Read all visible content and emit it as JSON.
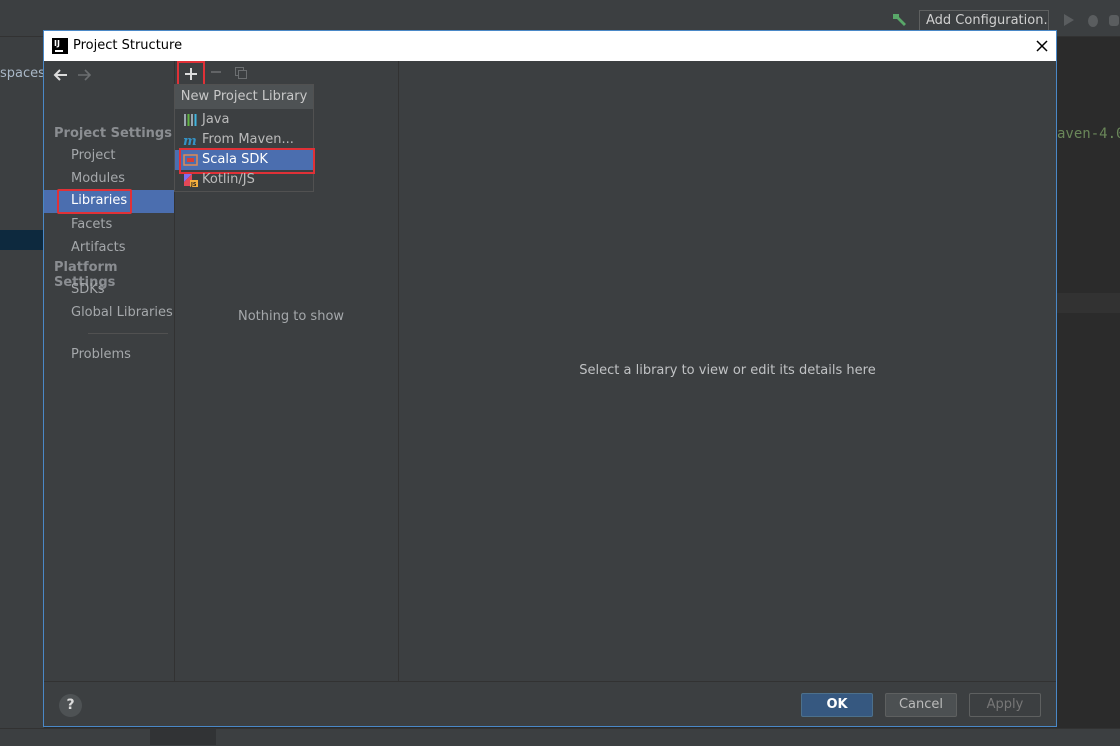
{
  "ide": {
    "add_configuration": "Add Configuration...",
    "left_path_fragment": "spaces\\",
    "code_fragment": "aven-4.0"
  },
  "dialog": {
    "title": "Project Structure",
    "sidebar": {
      "project_settings_header": "Project Settings",
      "project_settings_items": [
        "Project",
        "Modules",
        "Libraries",
        "Facets",
        "Artifacts"
      ],
      "platform_settings_header": "Platform Settings",
      "platform_settings_items": [
        "SDKs",
        "Global Libraries"
      ],
      "problems": "Problems",
      "selected": "Libraries"
    },
    "libraries": {
      "empty_text": "Nothing to show"
    },
    "details": {
      "hint": "Select a library to view or edit its details here"
    },
    "footer": {
      "help": "?",
      "ok": "OK",
      "cancel": "Cancel",
      "apply": "Apply"
    },
    "popup": {
      "header": "New Project Library",
      "items": [
        {
          "label": "Java",
          "icon": "java-library-icon"
        },
        {
          "label": "From Maven...",
          "icon": "maven-icon"
        },
        {
          "label": "Scala SDK",
          "icon": "scala-sdk-icon"
        },
        {
          "label": "Kotlin/JS",
          "icon": "kotlin-js-icon"
        }
      ],
      "highlighted": "Scala SDK"
    }
  },
  "colors": {
    "selection": "#4b6eaf",
    "highlight_box": "#e03137",
    "ok_button": "#365880"
  }
}
